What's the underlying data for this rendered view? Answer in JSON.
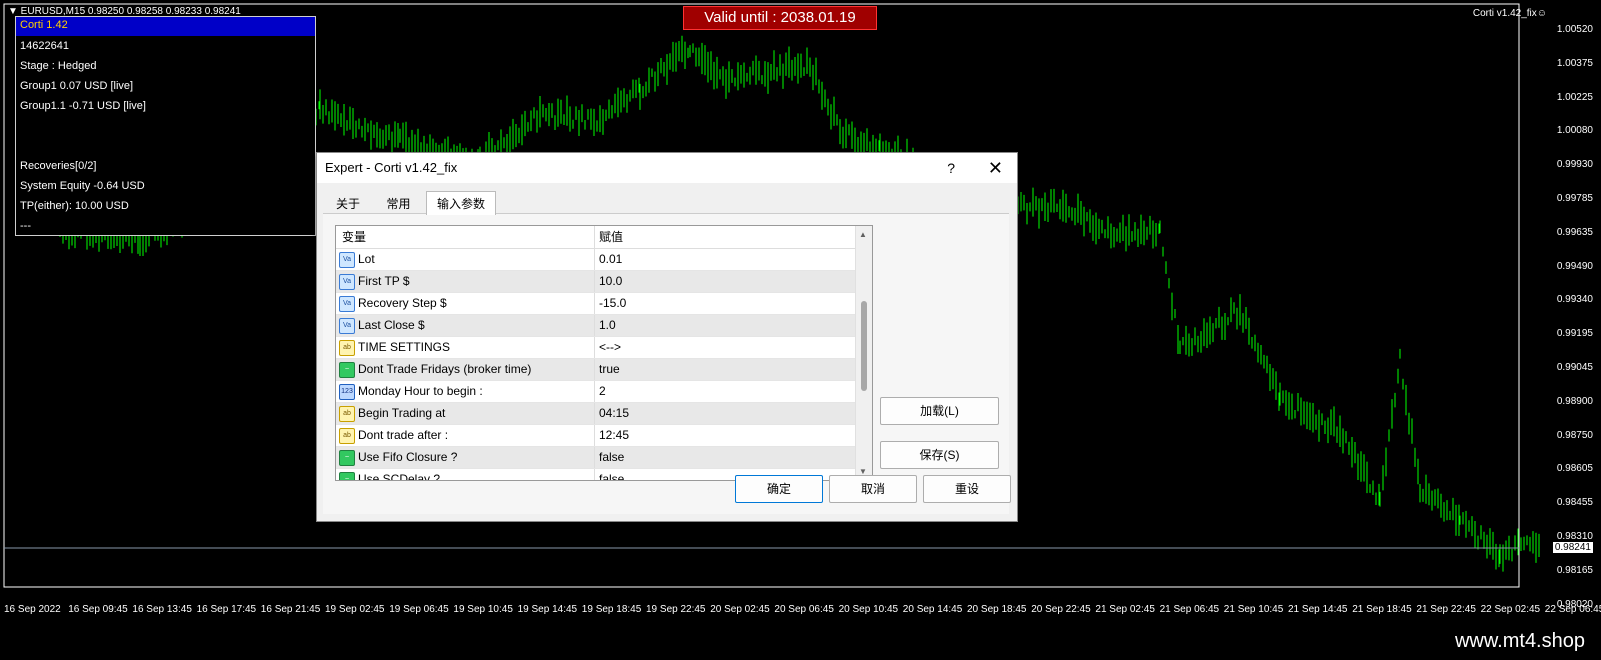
{
  "chart": {
    "symbol_line": "▼ EURUSD,M15 0.98250 0.98258 0.98233 0.98241",
    "ea_name_right": "Corti v1.42_fix☺",
    "valid_until": "Valid until : 2038.01.19",
    "current_price": "0.98241",
    "candle_color": "#00ff00",
    "price_axis": [
      "1.00520",
      "1.00375",
      "1.00225",
      "1.00080",
      "0.99930",
      "0.99785",
      "0.99635",
      "0.99490",
      "0.99340",
      "0.99195",
      "0.99045",
      "0.98900",
      "0.98750",
      "0.98605",
      "0.98455",
      "0.98310",
      "0.98165",
      "0.98020"
    ],
    "time_axis": [
      "16 Sep 2022",
      "16 Sep 09:45",
      "16 Sep 13:45",
      "16 Sep 17:45",
      "16 Sep 21:45",
      "19 Sep 02:45",
      "19 Sep 06:45",
      "19 Sep 10:45",
      "19 Sep 14:45",
      "19 Sep 18:45",
      "19 Sep 22:45",
      "20 Sep 02:45",
      "20 Sep 06:45",
      "20 Sep 10:45",
      "20 Sep 14:45",
      "20 Sep 18:45",
      "20 Sep 22:45",
      "21 Sep 02:45",
      "21 Sep 06:45",
      "21 Sep 10:45",
      "21 Sep 14:45",
      "21 Sep 18:45",
      "21 Sep 22:45",
      "22 Sep 02:45",
      "22 Sep 06:45"
    ],
    "watermark": "www.mt4.shop"
  },
  "info_panel": {
    "title": "Corti 1.42",
    "rows": [
      "14622641",
      "Stage : Hedged",
      "Group1 0.07 USD [live]",
      "Group1.1 -0.71 USD [live]",
      "",
      "",
      "Recoveries[0/2]",
      "System Equity -0.64 USD",
      "TP(either): 10.00 USD",
      "---"
    ]
  },
  "dialog": {
    "title": "Expert - Corti v1.42_fix",
    "help": "?",
    "close": "✕",
    "tabs": [
      "关于",
      "常用",
      "输入参数"
    ],
    "grid_header": {
      "variable": "变量",
      "value": "赋值"
    },
    "rows": [
      {
        "icon": "Va",
        "type": "num",
        "name": "Lot",
        "value": "0.01"
      },
      {
        "icon": "Va",
        "type": "num",
        "name": "First TP $",
        "value": "10.0"
      },
      {
        "icon": "Va",
        "type": "num",
        "name": "Recovery Step $",
        "value": "-15.0"
      },
      {
        "icon": "Va",
        "type": "num",
        "name": "Last Close $",
        "value": "1.0"
      },
      {
        "icon": "ab",
        "type": "str",
        "name": "TIME SETTINGS",
        "value": "<-->"
      },
      {
        "icon": "~",
        "type": "bool",
        "name": "Dont Trade Fridays (broker time)",
        "value": "true"
      },
      {
        "icon": "123",
        "type": "int",
        "name": "Monday Hour to begin :",
        "value": "2"
      },
      {
        "icon": "ab",
        "type": "str",
        "name": "Begin Trading at",
        "value": "04:15"
      },
      {
        "icon": "ab",
        "type": "str",
        "name": "Dont trade after :",
        "value": "12:45"
      },
      {
        "icon": "~",
        "type": "bool",
        "name": "Use Fifo Closure ?",
        "value": "false"
      },
      {
        "icon": "~",
        "type": "bool",
        "name": "Use SCDelay ?",
        "value": "false"
      }
    ],
    "buttons": {
      "load": "加载(L)",
      "save": "保存(S)",
      "ok": "确定",
      "cancel": "取消",
      "reset": "重设"
    }
  }
}
